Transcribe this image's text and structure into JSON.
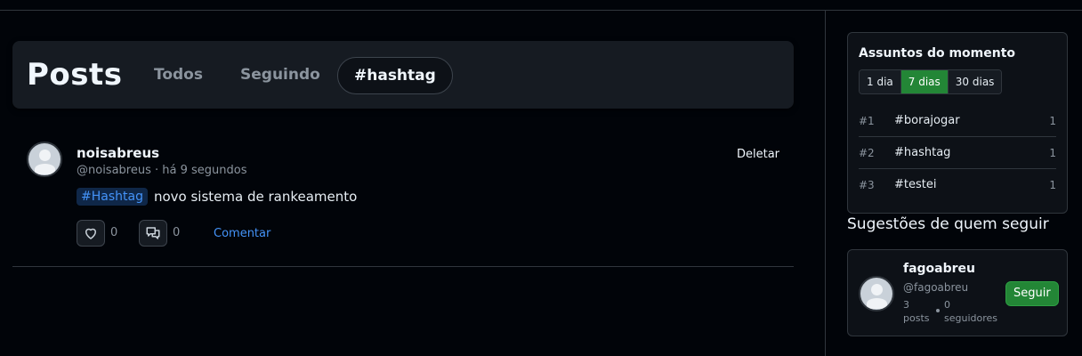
{
  "header": {
    "title": "Posts",
    "tabs": [
      {
        "label": "Todos",
        "active": false
      },
      {
        "label": "Seguindo",
        "active": false
      },
      {
        "label": "#hashtag",
        "active": true
      }
    ]
  },
  "post": {
    "author_name": "noisabreus",
    "author_meta": "@noisabreus · há 9 segundos",
    "delete_label": "Deletar",
    "hashtag": "#Hashtag",
    "text": "novo sistema de rankeamento",
    "likes": "0",
    "comments": "0",
    "comment_label": "Comentar",
    "icons": {
      "like": "heart-icon",
      "comment": "chat-bubbles-icon",
      "avatar": "user-avatar-icon"
    }
  },
  "trends": {
    "title": "Assuntos do momento",
    "periods": [
      {
        "label": "1 dia",
        "active": false
      },
      {
        "label": "7 dias",
        "active": true
      },
      {
        "label": "30 dias",
        "active": false
      }
    ],
    "items": [
      {
        "rank": "#1",
        "tag": "#borajogar",
        "count": "1"
      },
      {
        "rank": "#2",
        "tag": "#hashtag",
        "count": "1"
      },
      {
        "rank": "#3",
        "tag": "#testei",
        "count": "1"
      }
    ]
  },
  "suggestions": {
    "title": "Sugestões de quem seguir",
    "users": [
      {
        "name": "fagoabreu",
        "handle": "@fagoabreu",
        "posts_count": "3",
        "posts_label": "posts",
        "followers_count": "0",
        "followers_label": "seguidores",
        "follow_label": "Seguir"
      }
    ]
  },
  "colors": {
    "background": "#010409",
    "panel": "#161b22",
    "accent_green": "#238636",
    "link_blue": "#4493f8",
    "muted": "#8b949e"
  }
}
